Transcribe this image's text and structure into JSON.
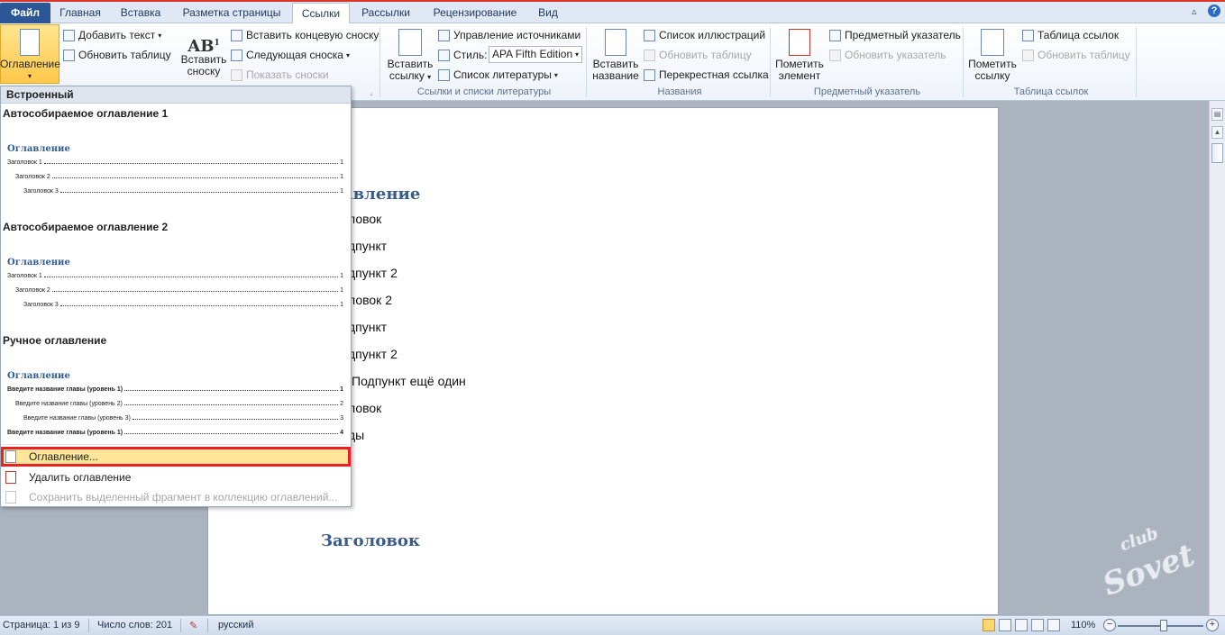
{
  "tabs": [
    {
      "label": "Файл",
      "kind": "file"
    },
    {
      "label": "Главная"
    },
    {
      "label": "Вставка"
    },
    {
      "label": "Разметка страницы"
    },
    {
      "label": "Ссылки",
      "active": true
    },
    {
      "label": "Рассылки"
    },
    {
      "label": "Рецензирование"
    },
    {
      "label": "Вид"
    }
  ],
  "ribbon": {
    "toc_button": "Оглавление",
    "add_text": "Добавить текст",
    "update_table": "Обновить таблицу",
    "insert_footnote_line1": "Вставить",
    "insert_footnote_line2": "сноску",
    "insert_endnote": "Вставить концевую сноску",
    "next_footnote": "Следующая сноска",
    "show_notes": "Показать сноски",
    "insert_citation_line1": "Вставить",
    "insert_citation_line2": "ссылку",
    "manage_sources": "Управление источниками",
    "style_label": "Стиль:",
    "style_value": "APA Fifth Edition",
    "bibliography": "Список литературы",
    "citations_group": "Ссылки и списки литературы",
    "insert_caption_line1": "Вставить",
    "insert_caption_line2": "название",
    "insert_table_of_figures": "Список иллюстраций",
    "update_table_captions": "Обновить таблицу",
    "cross_reference": "Перекрестная ссылка",
    "captions_group": "Названия",
    "mark_entry_line1": "Пометить",
    "mark_entry_line2": "элемент",
    "insert_index": "Предметный указатель",
    "update_index": "Обновить указатель",
    "index_group": "Предметный указатель",
    "mark_citation_line1": "Пометить",
    "mark_citation_line2": "ссылку",
    "table_of_authorities": "Таблица ссылок",
    "update_authorities": "Обновить таблицу",
    "authorities_group": "Таблица ссылок"
  },
  "dropdown": {
    "header": "Встроенный",
    "sections": [
      {
        "title": "Автособираемое оглавление 1",
        "preview_title": "Оглавление",
        "lines": [
          {
            "label": "Заголовок 1",
            "page": "1"
          },
          {
            "label": "Заголовок 2",
            "page": "1"
          },
          {
            "label": "Заголовок 3",
            "page": "1"
          }
        ]
      },
      {
        "title": "Автособираемое оглавление 2",
        "preview_title": "Оглавление",
        "lines": [
          {
            "label": "Заголовок 1",
            "page": "1"
          },
          {
            "label": "Заголовок 2",
            "page": "1"
          },
          {
            "label": "Заголовок 3",
            "page": "1"
          }
        ]
      },
      {
        "title": "Ручное оглавление",
        "preview_title": "Оглавление",
        "lines": [
          {
            "label": "Введите название главы (уровень 1)",
            "page": "1"
          },
          {
            "label": "Введите название главы (уровень 2)",
            "page": "2"
          },
          {
            "label": "Введите название главы (уровень 3)",
            "page": "3"
          },
          {
            "label": "Введите название главы (уровень 1)",
            "page": "4"
          }
        ]
      }
    ],
    "commands": [
      {
        "label": "Оглавление...",
        "highlighted": true
      },
      {
        "label": "Удалить оглавление"
      },
      {
        "label": "Сохранить выделенный фрагмент в коллекцию оглавлений...",
        "disabled": true
      }
    ]
  },
  "document": {
    "heading": "авление",
    "lines": [
      "ловок",
      "дпункт",
      "дпункт 2",
      "ловок 2",
      "дпункт",
      "дпункт 2",
      "Подпункт ещё один",
      "ловок",
      "ды"
    ],
    "bottom_heading": "Заголовок"
  },
  "statusbar": {
    "page": "Страница: 1 из 9",
    "words": "Число слов: 201",
    "language": "русский",
    "zoom": "110%"
  },
  "watermark": {
    "line1": "club",
    "line2": "Sovet"
  }
}
